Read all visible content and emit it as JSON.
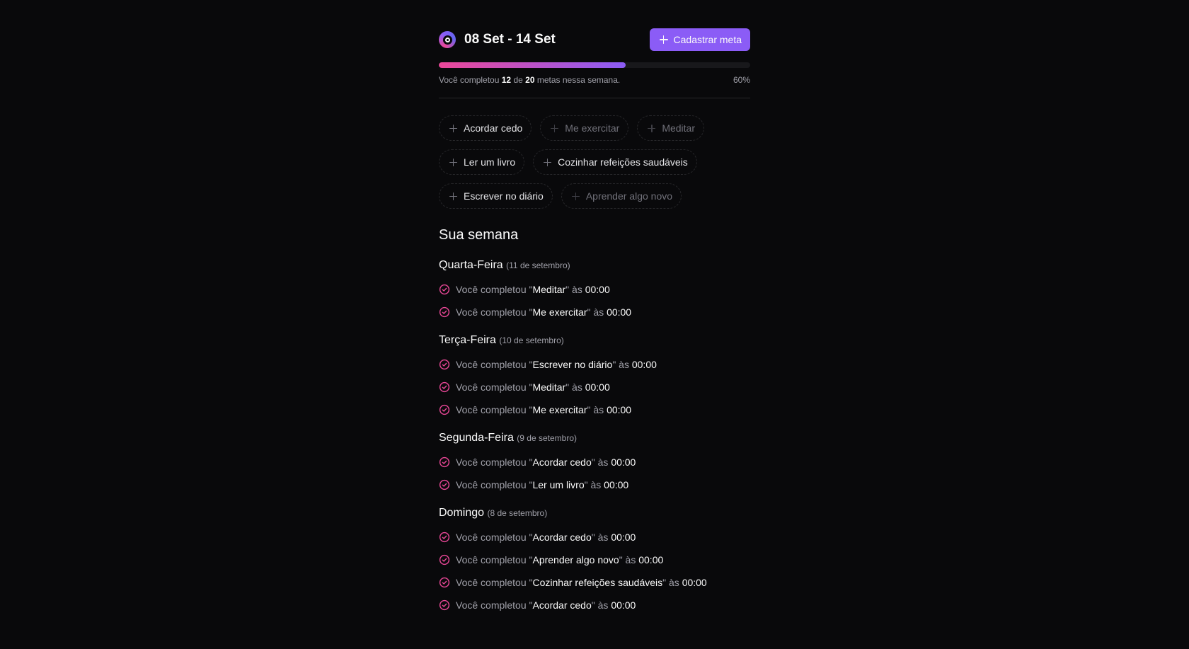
{
  "header": {
    "week_range": "08 Set - 14 Set",
    "new_goal_label": "Cadastrar meta"
  },
  "progress": {
    "prefix": "Você completou",
    "completed": "12",
    "of_word": "de",
    "total": "20",
    "suffix": "metas nessa semana.",
    "percent_label": "60%",
    "fill_fraction": 0.6,
    "gradient_from": "#ec4899",
    "gradient_to": "#8b5cf6"
  },
  "goals": [
    {
      "label": "Acordar cedo",
      "disabled": false
    },
    {
      "label": "Me exercitar",
      "disabled": true
    },
    {
      "label": "Meditar",
      "disabled": true
    },
    {
      "label": "Ler um livro",
      "disabled": false
    },
    {
      "label": "Cozinhar refeições saudáveis",
      "disabled": false
    },
    {
      "label": "Escrever no diário",
      "disabled": false
    },
    {
      "label": "Aprender algo novo",
      "disabled": true
    }
  ],
  "summary": {
    "title": "Sua semana",
    "entry_prefix": "Você completou \"",
    "entry_middle": "\" às ",
    "check_color": "#ec4899",
    "days": [
      {
        "name": "Quarta-Feira",
        "date": "(11 de setembro)",
        "entries": [
          {
            "goal": "Meditar",
            "time": "00:00"
          },
          {
            "goal": "Me exercitar",
            "time": "00:00"
          }
        ]
      },
      {
        "name": "Terça-Feira",
        "date": "(10 de setembro)",
        "entries": [
          {
            "goal": "Escrever no diário",
            "time": "00:00"
          },
          {
            "goal": "Meditar",
            "time": "00:00"
          },
          {
            "goal": "Me exercitar",
            "time": "00:00"
          }
        ]
      },
      {
        "name": "Segunda-Feira",
        "date": "(9 de setembro)",
        "entries": [
          {
            "goal": "Acordar cedo",
            "time": "00:00"
          },
          {
            "goal": "Ler um livro",
            "time": "00:00"
          }
        ]
      },
      {
        "name": "Domingo",
        "date": "(8 de setembro)",
        "entries": [
          {
            "goal": "Acordar cedo",
            "time": "00:00"
          },
          {
            "goal": "Aprender algo novo",
            "time": "00:00"
          },
          {
            "goal": "Cozinhar refeições saudáveis",
            "time": "00:00"
          },
          {
            "goal": "Acordar cedo",
            "time": "00:00"
          }
        ]
      }
    ]
  }
}
